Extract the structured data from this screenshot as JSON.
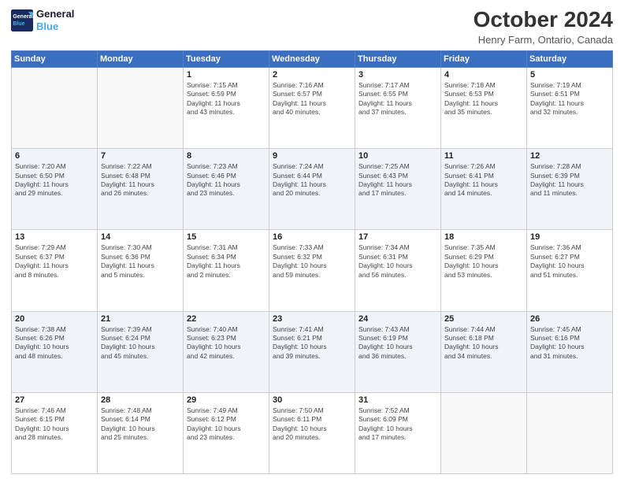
{
  "logo": {
    "line1": "General",
    "line2": "Blue"
  },
  "title": "October 2024",
  "location": "Henry Farm, Ontario, Canada",
  "weekdays": [
    "Sunday",
    "Monday",
    "Tuesday",
    "Wednesday",
    "Thursday",
    "Friday",
    "Saturday"
  ],
  "rows": [
    [
      {
        "day": "",
        "empty": true
      },
      {
        "day": "",
        "empty": true
      },
      {
        "day": "1",
        "info": "Sunrise: 7:15 AM\nSunset: 6:59 PM\nDaylight: 11 hours\nand 43 minutes."
      },
      {
        "day": "2",
        "info": "Sunrise: 7:16 AM\nSunset: 6:57 PM\nDaylight: 11 hours\nand 40 minutes."
      },
      {
        "day": "3",
        "info": "Sunrise: 7:17 AM\nSunset: 6:55 PM\nDaylight: 11 hours\nand 37 minutes."
      },
      {
        "day": "4",
        "info": "Sunrise: 7:18 AM\nSunset: 6:53 PM\nDaylight: 11 hours\nand 35 minutes."
      },
      {
        "day": "5",
        "info": "Sunrise: 7:19 AM\nSunset: 6:51 PM\nDaylight: 11 hours\nand 32 minutes."
      }
    ],
    [
      {
        "day": "6",
        "info": "Sunrise: 7:20 AM\nSunset: 6:50 PM\nDaylight: 11 hours\nand 29 minutes."
      },
      {
        "day": "7",
        "info": "Sunrise: 7:22 AM\nSunset: 6:48 PM\nDaylight: 11 hours\nand 26 minutes."
      },
      {
        "day": "8",
        "info": "Sunrise: 7:23 AM\nSunset: 6:46 PM\nDaylight: 11 hours\nand 23 minutes."
      },
      {
        "day": "9",
        "info": "Sunrise: 7:24 AM\nSunset: 6:44 PM\nDaylight: 11 hours\nand 20 minutes."
      },
      {
        "day": "10",
        "info": "Sunrise: 7:25 AM\nSunset: 6:43 PM\nDaylight: 11 hours\nand 17 minutes."
      },
      {
        "day": "11",
        "info": "Sunrise: 7:26 AM\nSunset: 6:41 PM\nDaylight: 11 hours\nand 14 minutes."
      },
      {
        "day": "12",
        "info": "Sunrise: 7:28 AM\nSunset: 6:39 PM\nDaylight: 11 hours\nand 11 minutes."
      }
    ],
    [
      {
        "day": "13",
        "info": "Sunrise: 7:29 AM\nSunset: 6:37 PM\nDaylight: 11 hours\nand 8 minutes."
      },
      {
        "day": "14",
        "info": "Sunrise: 7:30 AM\nSunset: 6:36 PM\nDaylight: 11 hours\nand 5 minutes."
      },
      {
        "day": "15",
        "info": "Sunrise: 7:31 AM\nSunset: 6:34 PM\nDaylight: 11 hours\nand 2 minutes."
      },
      {
        "day": "16",
        "info": "Sunrise: 7:33 AM\nSunset: 6:32 PM\nDaylight: 10 hours\nand 59 minutes."
      },
      {
        "day": "17",
        "info": "Sunrise: 7:34 AM\nSunset: 6:31 PM\nDaylight: 10 hours\nand 56 minutes."
      },
      {
        "day": "18",
        "info": "Sunrise: 7:35 AM\nSunset: 6:29 PM\nDaylight: 10 hours\nand 53 minutes."
      },
      {
        "day": "19",
        "info": "Sunrise: 7:36 AM\nSunset: 6:27 PM\nDaylight: 10 hours\nand 51 minutes."
      }
    ],
    [
      {
        "day": "20",
        "info": "Sunrise: 7:38 AM\nSunset: 6:26 PM\nDaylight: 10 hours\nand 48 minutes."
      },
      {
        "day": "21",
        "info": "Sunrise: 7:39 AM\nSunset: 6:24 PM\nDaylight: 10 hours\nand 45 minutes."
      },
      {
        "day": "22",
        "info": "Sunrise: 7:40 AM\nSunset: 6:23 PM\nDaylight: 10 hours\nand 42 minutes."
      },
      {
        "day": "23",
        "info": "Sunrise: 7:41 AM\nSunset: 6:21 PM\nDaylight: 10 hours\nand 39 minutes."
      },
      {
        "day": "24",
        "info": "Sunrise: 7:43 AM\nSunset: 6:19 PM\nDaylight: 10 hours\nand 36 minutes."
      },
      {
        "day": "25",
        "info": "Sunrise: 7:44 AM\nSunset: 6:18 PM\nDaylight: 10 hours\nand 34 minutes."
      },
      {
        "day": "26",
        "info": "Sunrise: 7:45 AM\nSunset: 6:16 PM\nDaylight: 10 hours\nand 31 minutes."
      }
    ],
    [
      {
        "day": "27",
        "info": "Sunrise: 7:46 AM\nSunset: 6:15 PM\nDaylight: 10 hours\nand 28 minutes."
      },
      {
        "day": "28",
        "info": "Sunrise: 7:48 AM\nSunset: 6:14 PM\nDaylight: 10 hours\nand 25 minutes."
      },
      {
        "day": "29",
        "info": "Sunrise: 7:49 AM\nSunset: 6:12 PM\nDaylight: 10 hours\nand 23 minutes."
      },
      {
        "day": "30",
        "info": "Sunrise: 7:50 AM\nSunset: 6:11 PM\nDaylight: 10 hours\nand 20 minutes."
      },
      {
        "day": "31",
        "info": "Sunrise: 7:52 AM\nSunset: 6:09 PM\nDaylight: 10 hours\nand 17 minutes."
      },
      {
        "day": "",
        "empty": true
      },
      {
        "day": "",
        "empty": true
      }
    ]
  ]
}
